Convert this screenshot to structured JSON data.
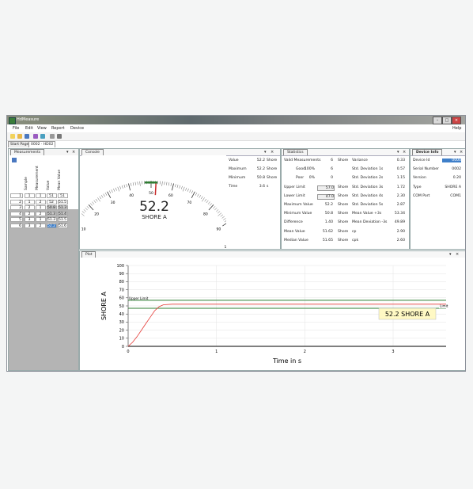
{
  "app": {
    "title": "HdMeasure"
  },
  "menu": [
    "File",
    "Edit",
    "View",
    "Report",
    "Device"
  ],
  "help": "Help",
  "toolbar": {
    "icons": [
      "new-icon",
      "open-icon",
      "save-icon",
      "chart-icon",
      "export-icon",
      "print-icon",
      "printer-icon"
    ]
  },
  "tabs": [
    "Start Page",
    "0002 · HD02"
  ],
  "measurements": {
    "title": "Measurements",
    "headers": [
      "Sample",
      "Measurement",
      "Value",
      "Mean Value"
    ],
    "rows": [
      [
        "1",
        "1",
        "1",
        "51",
        "51"
      ],
      [
        "2",
        "1",
        "2",
        "52",
        "51.5"
      ],
      [
        "3",
        "2",
        "1",
        "50.8",
        "51.3"
      ],
      [
        "4",
        "2",
        "2",
        "51.3",
        "51.4"
      ],
      [
        "5",
        "3",
        "1",
        "51.3",
        "51.5"
      ],
      [
        "6",
        "3",
        "2",
        "52.2",
        "51.6"
      ]
    ]
  },
  "console": {
    "title": "Console",
    "gauge_value": "52.2",
    "gauge_unit": "SHORE A",
    "scale": [
      "0",
      "10",
      "20",
      "30",
      "40",
      "50",
      "60",
      "70",
      "80",
      "90",
      "100"
    ],
    "level": 0.522,
    "readings": [
      {
        "label": "Value",
        "value": "52.2",
        "unit": "Shore"
      },
      {
        "label": "Maximum",
        "value": "52.2",
        "unit": "Shore"
      },
      {
        "label": "Minimum",
        "value": "50.8",
        "unit": "Shore"
      },
      {
        "label": "Time",
        "value": "3.6",
        "unit": "s"
      }
    ]
  },
  "statistics": {
    "title": "Statistics",
    "left": [
      {
        "label": "Valid Measurements",
        "value": "6",
        "unit": "Shore"
      },
      {
        "label": "Good",
        "pct": "100%",
        "value": "6"
      },
      {
        "label": "Poor",
        "pct": "0%",
        "value": "0"
      },
      {
        "label": "Upper Limit",
        "value": "57.0",
        "unit": "Shore"
      },
      {
        "label": "Lower Limit",
        "value": "47.0",
        "unit": "Shore"
      },
      {
        "label": "Maximum Value",
        "value": "52.2",
        "unit": "Shore"
      },
      {
        "label": "Minimum Value",
        "value": "50.8",
        "unit": "Shore"
      },
      {
        "label": "Difference",
        "value": "1.40",
        "unit": "Shore"
      },
      {
        "label": "Mean Value",
        "value": "51.62",
        "unit": "Shore"
      },
      {
        "label": "Median Value",
        "value": "51.65",
        "unit": "Shore"
      }
    ],
    "right": [
      {
        "label": "Variance",
        "value": "0.33"
      },
      {
        "label": "Std. Deviation 1s",
        "value": "0.57"
      },
      {
        "label": "Std. Deviation 2s",
        "value": "1.15"
      },
      {
        "label": "Std. Deviation 3s",
        "value": "1.72"
      },
      {
        "label": "Std. Deviation 4s",
        "value": "2.30"
      },
      {
        "label": "Std. Deviation 5s",
        "value": "2.87"
      },
      {
        "label": "Mean Value +3s",
        "value": "53.34"
      },
      {
        "label": "Mean Deviation -3s",
        "value": "49.89"
      },
      {
        "label": "cp",
        "value": "2.90"
      },
      {
        "label": "cpk",
        "value": "2.60"
      }
    ]
  },
  "device": {
    "title": "Device Info",
    "rows": [
      {
        "label": "Device Id",
        "value": "0000"
      },
      {
        "label": "Serial Number",
        "value": "0002"
      },
      {
        "label": "Version",
        "value": "0.20"
      },
      {
        "label": "Type",
        "value": "SHORE A"
      },
      {
        "label": "COM Port",
        "value": "COM1"
      }
    ]
  },
  "plot": {
    "title": "Plot",
    "readout": "52.2 SHORE A",
    "upper_label": "Upper Limit",
    "lower_label": "Limit",
    "upper_color": "#2e7d32",
    "lower_color": "#2e7d32",
    "curve_color": "#e53935"
  },
  "chart_data": {
    "type": "line",
    "xlabel": "Time in s",
    "ylabel": "SHORE A",
    "xlim": [
      0,
      3.6
    ],
    "ylim": [
      0,
      100
    ],
    "xticks": [
      "0",
      "1",
      "2",
      "3"
    ],
    "yticks": [
      "0",
      "10",
      "20",
      "30",
      "40",
      "50",
      "60",
      "70",
      "80",
      "90",
      "100"
    ],
    "series": [
      {
        "x": [
          0,
          0.05,
          0.1,
          0.15,
          0.2,
          0.25,
          0.3,
          0.35,
          0.4,
          0.5,
          1,
          2,
          3,
          3.6
        ],
        "y": [
          0,
          5,
          12,
          20,
          28,
          36,
          44,
          49,
          51.5,
          52.2,
          52.2,
          52.2,
          52.2,
          52.2
        ]
      }
    ],
    "upper_limit": 57,
    "lower_limit": 47,
    "grid": true
  }
}
